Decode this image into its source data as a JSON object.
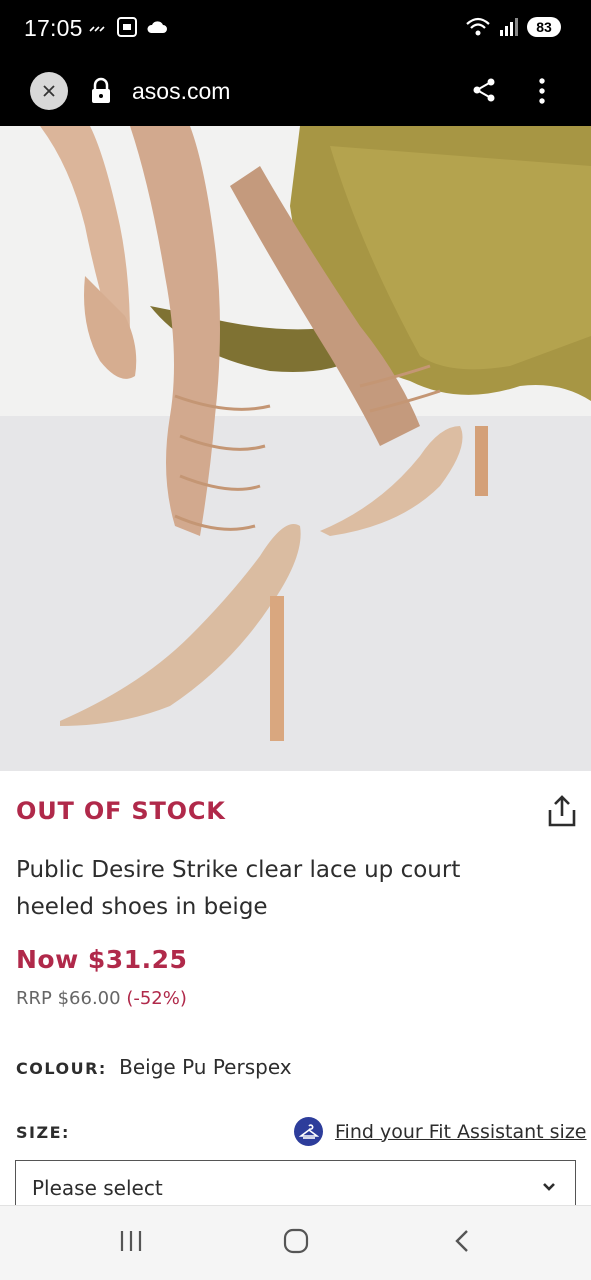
{
  "status_bar": {
    "time": "17:05",
    "battery": "83",
    "icons_left": [
      "missed-call-icon",
      "screenshot-icon",
      "cloud-icon"
    ],
    "icons_right": [
      "wifi-icon",
      "signal-icon",
      "battery-icon"
    ]
  },
  "browser": {
    "url": "asos.com",
    "icons": [
      "close-icon",
      "lock-icon",
      "share-icon",
      "more-vert-icon"
    ]
  },
  "carousel": {
    "image_alt": "",
    "dot_count": 4,
    "active_index": 0
  },
  "product": {
    "stock_status": "OUT OF STOCK",
    "title": "Public Desire Strike clear lace up court heeled shoes in beige",
    "price_now": "Now $31.25",
    "rrp_label": "RRP $66.00",
    "discount": "(-52%)",
    "colour_label": "COLOUR:",
    "colour_value": "Beige Pu Perspex",
    "size_label": "SIZE:",
    "fit_assistant_link": "Find your Fit Assistant size",
    "size_placeholder": "Please select"
  },
  "colors": {
    "accent": "#b0294a",
    "fit_badge": "#2d3d9b",
    "text": "#2d2d2d"
  },
  "nav_bar": {
    "icons": [
      "recent-apps-icon",
      "home-icon",
      "back-icon"
    ]
  }
}
